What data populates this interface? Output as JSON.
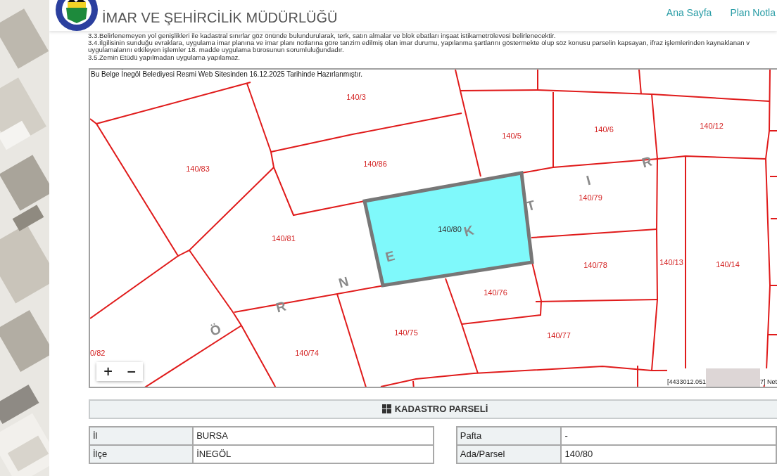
{
  "header": {
    "title": "İMAR VE ŞEHİRCİLİK MÜDÜRLÜĞÜ",
    "nav": [
      {
        "label": "Ana Sayfa"
      },
      {
        "label": "Plan Notla"
      }
    ]
  },
  "notes": [
    "3.3.Belirlenemeyen yol genişlikleri ile kadastral sınırlar göz önünde bulundurularak, terk, satın almalar ve blok ebatları inşaat istikametrölevesi belirlenecektir.",
    "3.4.İlgilisinin sunduğu evraklara, uygulama imar planına ve imar planı notlarına göre tanzim edilmiş olan imar durumu, yapılanma şartlarını göstermekte olup söz konusu parselin kapsayan, ifraz işlemlerinden kaynaklanan v",
    "uygulamalarını etkileyen işlemler 18. madde uygulama bürosunun sorumluluğundadır.",
    "3.5.Zemin Etüdü yapılmadan uygulama yapılamaz."
  ],
  "map": {
    "caption": "Bu Belge İnegöl Belediyesi Resmi Web Sitesinden 16.12.2025 Tarihinde Hazırlanmıştır.",
    "parcels": [
      {
        "label": "140/3",
        "selected": false
      },
      {
        "label": "140/83",
        "selected": false
      },
      {
        "label": "140/86",
        "selected": false
      },
      {
        "label": "140/81",
        "selected": false
      },
      {
        "label": "140/80",
        "selected": true
      },
      {
        "label": "140/5",
        "selected": false
      },
      {
        "label": "140/6",
        "selected": false
      },
      {
        "label": "140/12",
        "selected": false
      },
      {
        "label": "140/79",
        "selected": false
      },
      {
        "label": "140/78",
        "selected": false
      },
      {
        "label": "140/13",
        "selected": false
      },
      {
        "label": "140/14",
        "selected": false
      },
      {
        "label": "140/76",
        "selected": false
      },
      {
        "label": "140/75",
        "selected": false
      },
      {
        "label": "140/74",
        "selected": false
      },
      {
        "label": "140/77",
        "selected": false
      },
      {
        "label": "0/82",
        "selected": false
      }
    ],
    "street_letters": [
      "Ö",
      "R",
      "N",
      "E",
      "K",
      "T",
      "I",
      "R"
    ],
    "zoom_controls": [
      {
        "label": "+"
      },
      {
        "label": "−"
      }
    ],
    "coordinates": [
      "[4433012.051",
      "7] Net"
    ]
  },
  "section": {
    "title": "KADASTRO PARSELİ",
    "tables": [
      {
        "rows": [
          {
            "label": "İl",
            "value": "BURSA"
          },
          {
            "label": "İlçe",
            "value": "İNEGÖL"
          }
        ]
      },
      {
        "rows": [
          {
            "label": "Pafta",
            "value": "-"
          },
          {
            "label": "Ada/Parsel",
            "value": "140/80"
          }
        ]
      }
    ]
  }
}
